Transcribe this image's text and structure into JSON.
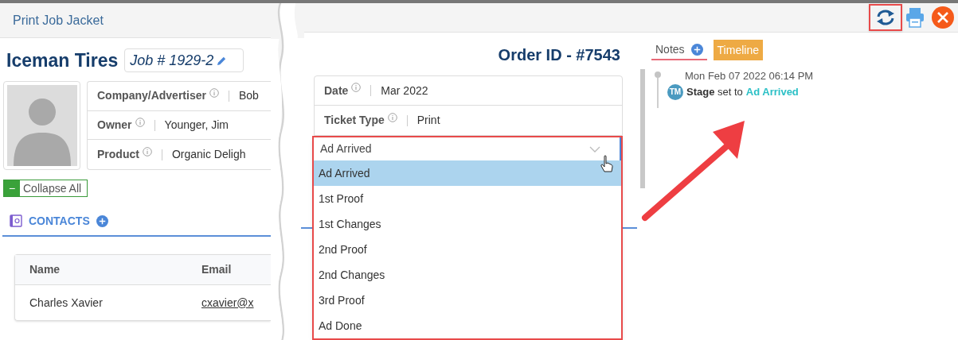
{
  "window": {
    "title": "Print Job Jacket"
  },
  "header": {
    "company": "Iceman Tires",
    "job": "Job # 1929-2",
    "order_id": "Order ID - #7543"
  },
  "details": [
    {
      "label": "Company/Advertiser",
      "value": "Bob"
    },
    {
      "label": "Owner",
      "value": "Younger, Jim"
    },
    {
      "label": "Product",
      "value": "Organic Deligh"
    }
  ],
  "schedule": [
    {
      "label": "Date",
      "value": "Mar 2022"
    },
    {
      "label": "Ticket Type",
      "value": "Print"
    }
  ],
  "collapse_button": {
    "symbol": "−",
    "label": "Collapse All"
  },
  "contacts": {
    "title": "CONTACTS",
    "columns": [
      "Name",
      "Email"
    ],
    "rows": [
      [
        "Charles Xavier",
        "cxavier@x"
      ]
    ]
  },
  "stage_select": {
    "value": "Ad Arrived",
    "options": [
      {
        "label": "Ad Arrived",
        "selected": true
      },
      {
        "label": "1st Proof",
        "selected": false
      },
      {
        "label": "1st Changes",
        "selected": false
      },
      {
        "label": "2nd Proof",
        "selected": false
      },
      {
        "label": "2nd Changes",
        "selected": false
      },
      {
        "label": "3rd Proof",
        "selected": false
      },
      {
        "label": "Ad Done",
        "selected": false
      }
    ]
  },
  "side_tabs": [
    {
      "label": "Notes",
      "selected": false
    },
    {
      "label": "Timeline",
      "selected": true
    }
  ],
  "timeline": [
    {
      "time": "Mon Feb 07 2022 06:14 PM",
      "initials": "TM",
      "text": "**Stage** set to",
      "value": "Ad Arrived"
    }
  ]
}
